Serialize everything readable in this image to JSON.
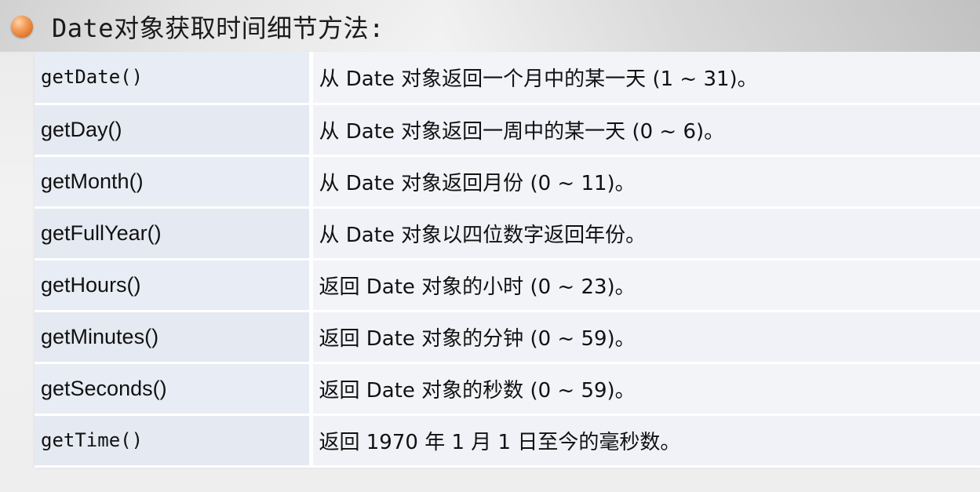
{
  "heading": {
    "title": "Date对象获取时间细节方法:"
  },
  "rows": [
    {
      "method": "getDate()",
      "description": "从 Date 对象返回一个月中的某一天 (1 ~ 31)。"
    },
    {
      "method": "getDay()",
      "description": "从 Date 对象返回一周中的某一天 (0 ~ 6)。"
    },
    {
      "method": "getMonth()",
      "description": "从 Date 对象返回月份 (0 ~ 11)。"
    },
    {
      "method": "getFullYear()",
      "description": "从 Date 对象以四位数字返回年份。"
    },
    {
      "method": "getHours()",
      "description": "返回 Date 对象的小时 (0 ~ 23)。"
    },
    {
      "method": "getMinutes()",
      "description": "返回 Date 对象的分钟 (0 ~ 59)。"
    },
    {
      "method": "getSeconds()",
      "description": "返回 Date 对象的秒数 (0 ~ 59)。"
    },
    {
      "method": "getTime()",
      "description": "返回 1970 年 1 月 1 日至今的毫秒数。"
    }
  ],
  "colors": {
    "bullet": "#e07425",
    "method_cell": "#e8ecf4",
    "description_cell": "#f3f4f8"
  },
  "icons": {
    "bullet": "orange-circle-bullet-icon"
  }
}
